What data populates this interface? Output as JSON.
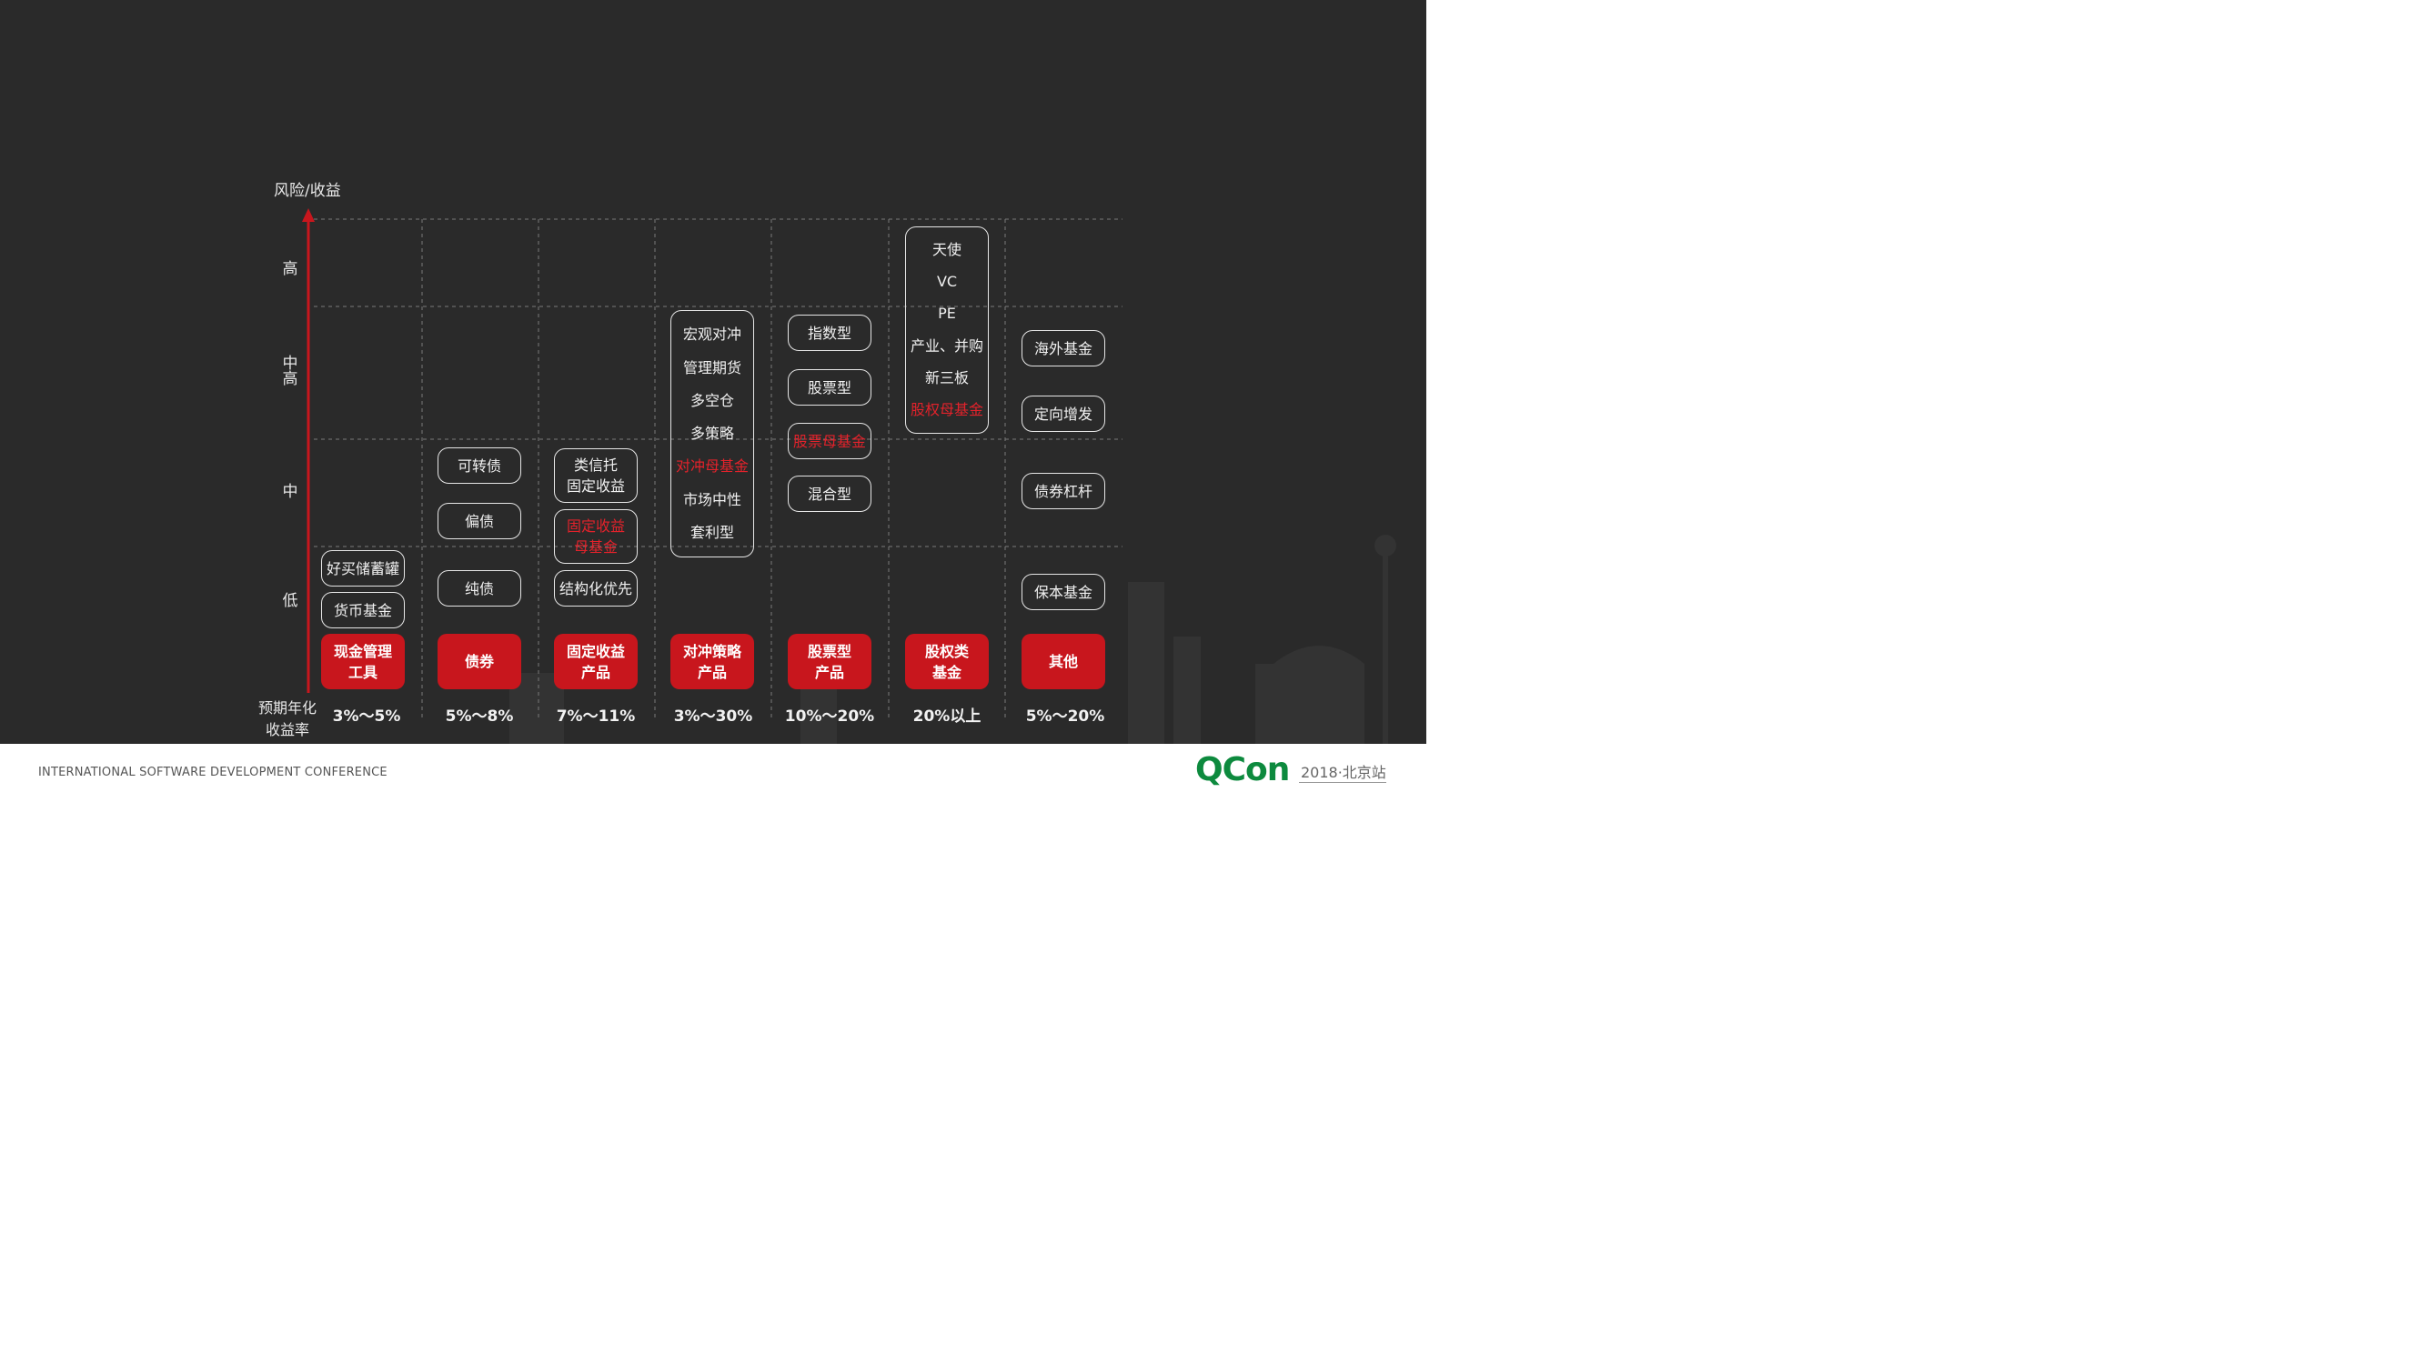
{
  "axis": {
    "title": "风险/收益",
    "expected_return_label": "预期年化收益率"
  },
  "levels": [
    "高",
    "中高",
    "中",
    "低"
  ],
  "categories": [
    {
      "name": "现金管理工具",
      "rate": "3%～5%"
    },
    {
      "name": "债券",
      "rate": "5%～8%"
    },
    {
      "name": "固定收益产品",
      "rate": "7%～11%"
    },
    {
      "name": "对冲策略产品",
      "rate": "3%～30%"
    },
    {
      "name": "股票型产品",
      "rate": "10%～20%"
    },
    {
      "name": "股权类基金",
      "rate": "20%以上"
    },
    {
      "name": "其他",
      "rate": "5%～20%"
    }
  ],
  "products": {
    "cash": [
      "好买储蓄罐",
      "货币基金"
    ],
    "bond": [
      "可转债",
      "偏债",
      "纯债"
    ],
    "fixed": [
      "类信托",
      "固定收益",
      "固定收益",
      "母基金",
      "结构化优先"
    ],
    "hedge": [
      "宏观对冲",
      "管理期货",
      "多空仓",
      "多策略",
      "对冲母基金",
      "市场中性",
      "套利型"
    ],
    "stock": [
      "指数型",
      "股票型",
      "股票母基金",
      "混合型"
    ],
    "equity": [
      "天使",
      "VC",
      "PE",
      "产业、并购",
      "新三板",
      "股权母基金"
    ],
    "other": [
      "海外基金",
      "定向增发",
      "债券杠杆",
      "保本基金"
    ]
  },
  "footer": {
    "conference": "INTERNATIONAL SOFTWARE DEVELOPMENT CONFERENCE",
    "logo": "QCon",
    "edition": "2018·北京站"
  },
  "colors": {
    "background": "#2a2a2a",
    "accent_red": "#c8161d",
    "text": "#f0f0f0",
    "logo_green": "#0d8a3e"
  }
}
